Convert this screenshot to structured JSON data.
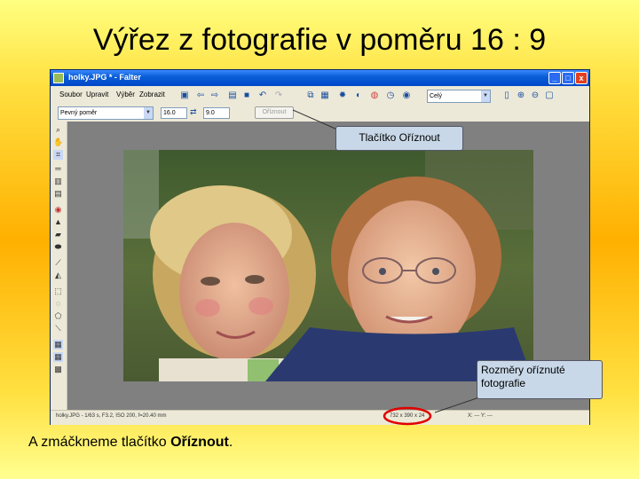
{
  "slide": {
    "title": "Výřez z fotografie v poměru 16 : 9",
    "note_prefix": "A zmáčkneme tlačítko ",
    "note_bold": "Oříznout",
    "note_suffix": "."
  },
  "window": {
    "title": "holky.JPG * - Falter",
    "min": "_",
    "max": "□",
    "close": "x"
  },
  "menu": {
    "items": [
      "Soubor",
      "Upravit",
      "Výběr",
      "Zobrazit"
    ],
    "zoom_combo": "Celý"
  },
  "options": {
    "ratio_combo": "Pevný poměr",
    "width_value": "16.0",
    "swap_icon": "swap-arrows-icon",
    "height_value": "9.0",
    "crop_button": "Oříznout"
  },
  "status": {
    "info": "holky.JPG - 1/63 s, F3.2, ISO 200, f=20.40 mm",
    "dimensions": "732 x 390 x 24",
    "coords": "X: --- Y: ---"
  },
  "callouts": {
    "crop_button": "Tlačítko Oříznout",
    "dimensions": "Rozměry oříznuté fotografie"
  },
  "colors": {
    "highlight_ring": "#e00000",
    "title_bar": "#0a5fd8",
    "workspace": "#808080"
  }
}
